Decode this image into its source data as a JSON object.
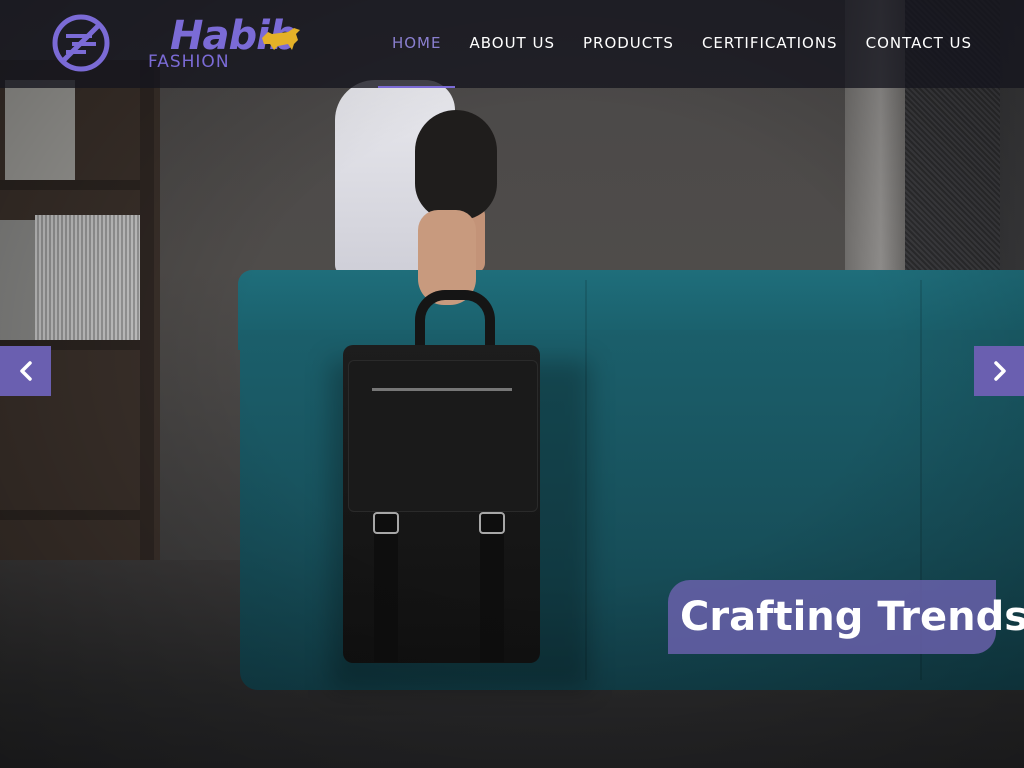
{
  "brand": {
    "name": "Habib",
    "tagline": "FASHION",
    "accent_color": "#7b6bd6",
    "bull_color": "#e4b128"
  },
  "nav": {
    "items": [
      {
        "label": "HOME",
        "active": true
      },
      {
        "label": "ABOUT US",
        "active": false
      },
      {
        "label": "PRODUCTS",
        "active": false
      },
      {
        "label": "CERTIFICATIONS",
        "active": false
      },
      {
        "label": "CONTACT US",
        "active": false
      }
    ]
  },
  "slider": {
    "caption": "Crafting Trends",
    "prev_icon": "chevron-left-icon",
    "next_icon": "chevron-right-icon",
    "arrow_color": "#6a5fb0"
  }
}
